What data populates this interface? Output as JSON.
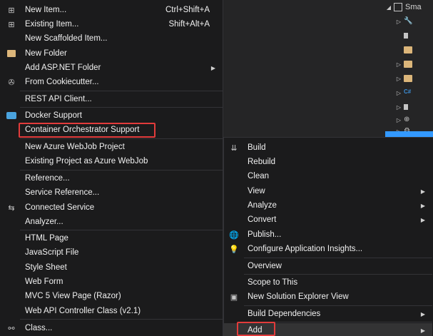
{
  "solution_explorer": {
    "root_label": "Sma",
    "rows": [
      {
        "label": "",
        "expander": "◢",
        "icon": "solution-icon"
      },
      {
        "label": "",
        "expander": "▷",
        "icon": "wrench-icon"
      },
      {
        "label": "",
        "expander": "",
        "icon": "file-icon"
      },
      {
        "label": "",
        "expander": "",
        "icon": "folder-icon"
      },
      {
        "label": "",
        "expander": "▷",
        "icon": "folder-icon"
      },
      {
        "label": "",
        "expander": "▷",
        "icon": "folder-icon"
      },
      {
        "label": "",
        "expander": "▷",
        "icon": "csharp-icon"
      },
      {
        "label": "",
        "expander": "▷",
        "icon": "file-icon"
      },
      {
        "label": "",
        "expander": "▷",
        "icon": "globe-icon"
      },
      {
        "label": "",
        "expander": "▷",
        "icon": "gear-icon"
      }
    ]
  },
  "menu_left": {
    "items": [
      {
        "label": "New Item...",
        "shortcut": "Ctrl+Shift+A",
        "icon": "new-item-icon"
      },
      {
        "label": "Existing Item...",
        "shortcut": "Shift+Alt+A",
        "icon": "existing-item-icon"
      },
      {
        "label": "New Scaffolded Item...",
        "shortcut": "",
        "icon": ""
      },
      {
        "label": "New Folder",
        "shortcut": "",
        "icon": "folder-icon"
      },
      {
        "label": "Add ASP.NET Folder",
        "shortcut": "",
        "icon": "",
        "submenu": true
      },
      {
        "label": "From Cookiecutter...",
        "shortcut": "",
        "icon": "cookiecutter-icon"
      },
      {
        "label": "REST API Client...",
        "shortcut": "",
        "icon": ""
      },
      {
        "label": "Docker Support",
        "shortcut": "",
        "icon": "docker-icon"
      },
      {
        "label": "Container Orchestrator Support",
        "shortcut": "",
        "icon": ""
      },
      {
        "label": "New Azure WebJob Project",
        "shortcut": "",
        "icon": ""
      },
      {
        "label": "Existing Project as Azure WebJob",
        "shortcut": "",
        "icon": ""
      },
      {
        "label": "Reference...",
        "shortcut": "",
        "icon": ""
      },
      {
        "label": "Service Reference...",
        "shortcut": "",
        "icon": ""
      },
      {
        "label": "Connected Service",
        "shortcut": "",
        "icon": "connected-service-icon"
      },
      {
        "label": "Analyzer...",
        "shortcut": "",
        "icon": ""
      },
      {
        "label": "HTML Page",
        "shortcut": "",
        "icon": ""
      },
      {
        "label": "JavaScript File",
        "shortcut": "",
        "icon": ""
      },
      {
        "label": "Style Sheet",
        "shortcut": "",
        "icon": ""
      },
      {
        "label": "Web Form",
        "shortcut": "",
        "icon": ""
      },
      {
        "label": "MVC 5 View Page (Razor)",
        "shortcut": "",
        "icon": ""
      },
      {
        "label": "Web API Controller Class (v2.1)",
        "shortcut": "",
        "icon": ""
      },
      {
        "label": "Class...",
        "shortcut": "",
        "icon": "class-icon"
      }
    ]
  },
  "menu_right": {
    "items": [
      {
        "label": "Build",
        "icon": "build-icon"
      },
      {
        "label": "Rebuild",
        "icon": ""
      },
      {
        "label": "Clean",
        "icon": ""
      },
      {
        "label": "View",
        "icon": "",
        "submenu": true
      },
      {
        "label": "Analyze",
        "icon": "",
        "submenu": true
      },
      {
        "label": "Convert",
        "icon": "",
        "submenu": true
      },
      {
        "label": "Publish...",
        "icon": "globe-icon"
      },
      {
        "label": "Configure Application Insights...",
        "icon": "insights-icon"
      },
      {
        "label": "Overview",
        "icon": ""
      },
      {
        "label": "Scope to This",
        "icon": ""
      },
      {
        "label": "New Solution Explorer View",
        "icon": "new-view-icon"
      },
      {
        "label": "Build Dependencies",
        "icon": "",
        "submenu": true
      },
      {
        "label": "Add",
        "icon": "",
        "submenu": true
      }
    ]
  },
  "colors": {
    "menu_bg": "#1b1b1c",
    "highlight_border": "#e23b3b",
    "selection_blue": "#3399ff",
    "text": "#f1f1f1"
  }
}
